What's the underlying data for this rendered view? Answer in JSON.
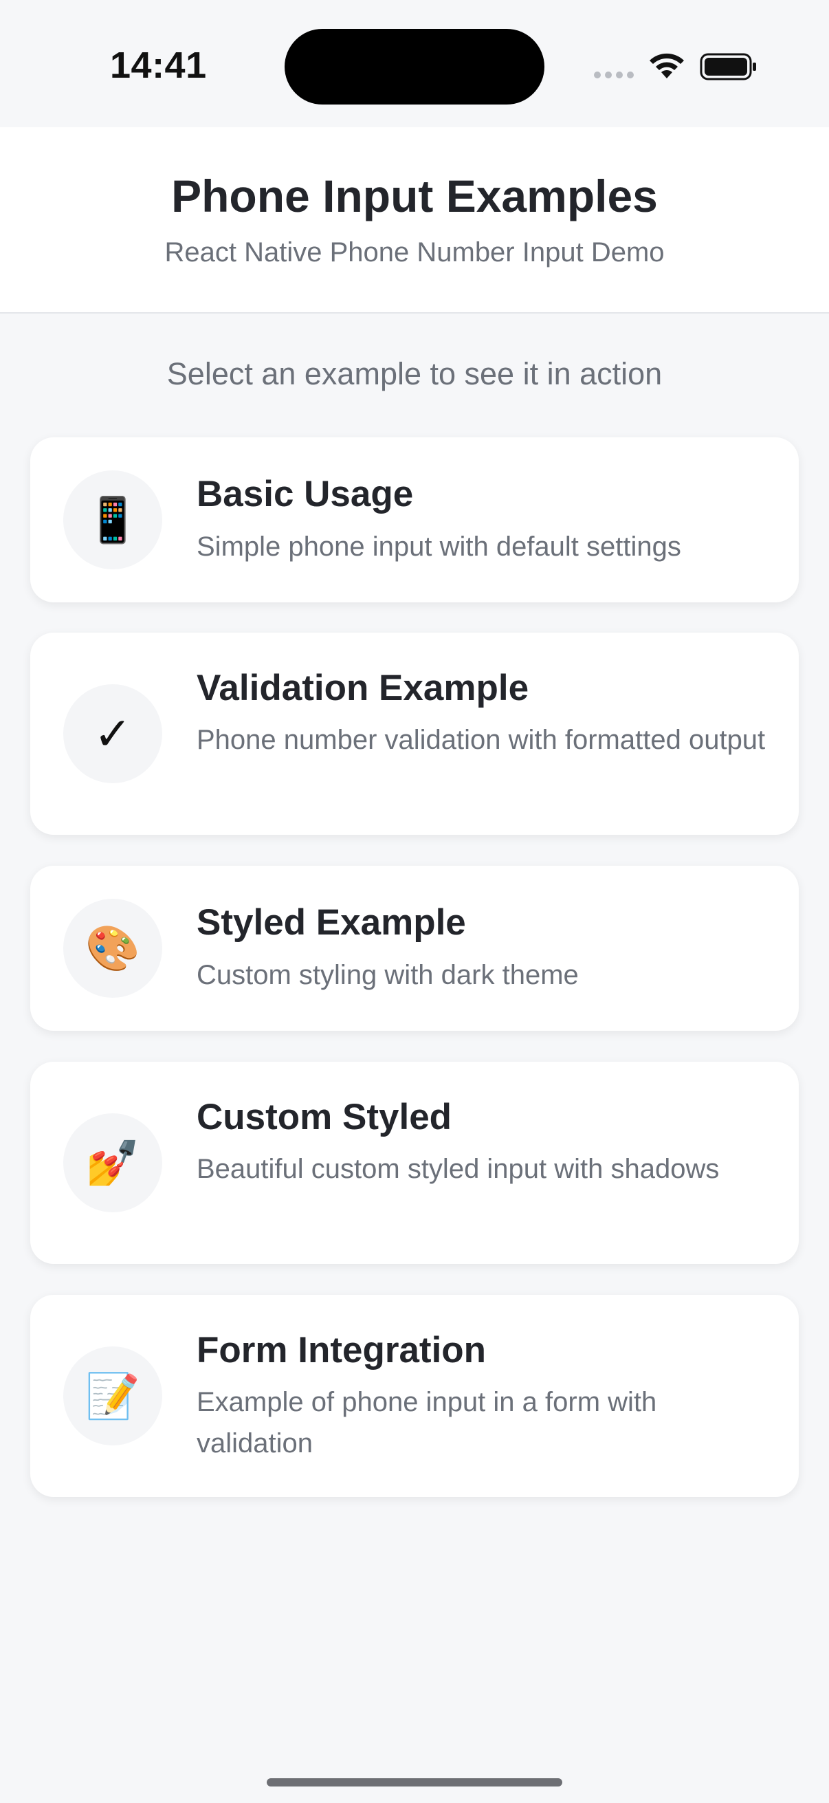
{
  "status_bar": {
    "time": "14:41"
  },
  "header": {
    "title": "Phone Input Examples",
    "subtitle": "React Native Phone Number Input Demo"
  },
  "intro_text": "Select an example to see it in action",
  "examples": [
    {
      "icon": "📱",
      "icon_name": "mobile-phone-icon",
      "title": "Basic Usage",
      "description": "Simple phone input with default settings"
    },
    {
      "icon": "✓",
      "icon_name": "check-mark-icon",
      "title": "Validation Example",
      "description": "Phone number validation with formatted output"
    },
    {
      "icon": "🎨",
      "icon_name": "artist-palette-icon",
      "title": "Styled Example",
      "description": "Custom styling with dark theme"
    },
    {
      "icon": "💅",
      "icon_name": "nail-polish-icon",
      "title": "Custom Styled",
      "description": "Beautiful custom styled input with shadows"
    },
    {
      "icon": "📝",
      "icon_name": "memo-icon",
      "title": "Form Integration",
      "description": "Example of phone input in a form with validation"
    }
  ],
  "colors": {
    "background": "#f6f7f9",
    "card": "#ffffff",
    "title_text": "#23252b",
    "secondary_text": "#6b7079"
  }
}
